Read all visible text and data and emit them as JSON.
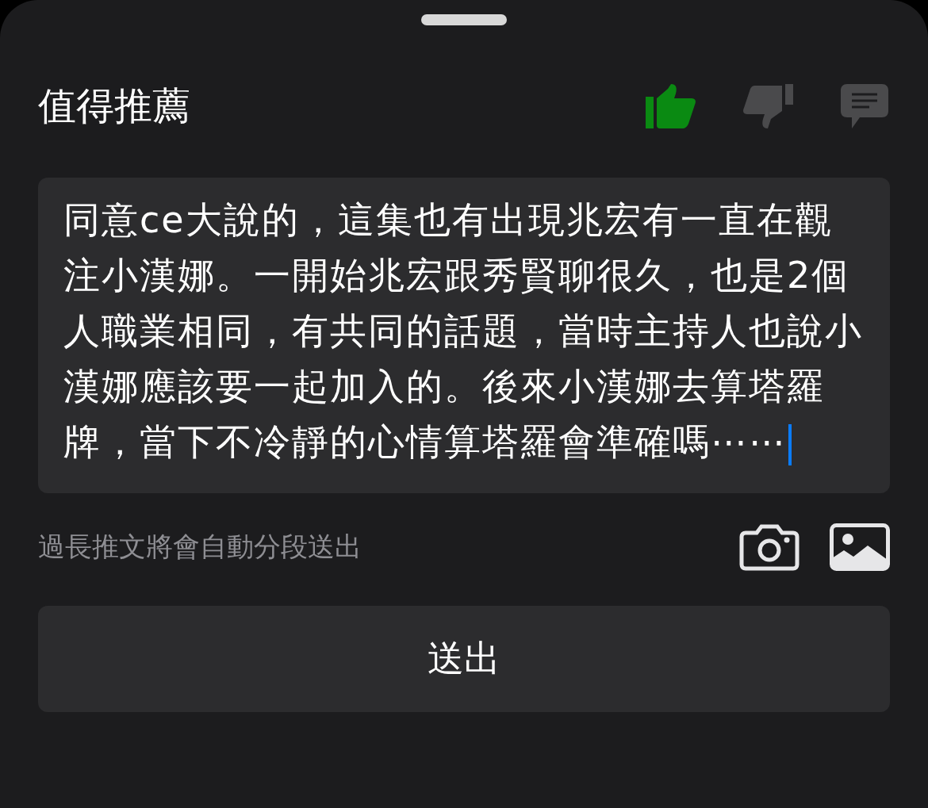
{
  "sheet": {
    "title": "值得推薦"
  },
  "reactions": [
    {
      "kind": "like",
      "selected": true
    },
    {
      "kind": "dislike",
      "selected": false
    },
    {
      "kind": "comment",
      "selected": false
    }
  ],
  "comment_field": {
    "value": "同意ce大說的，這集也有出現兆宏有一直在觀注小漢娜。一開始兆宏跟秀賢聊很久，也是2個人職業相同，有共同的話題，當時主持人也說小漢娜應該要一起加入的。後來小漢娜去算塔羅牌，當下不冷靜的心情算塔羅會準確嗎⋯⋯",
    "focused": true
  },
  "hint": "過長推文將會自動分段送出",
  "attachments": [
    {
      "kind": "camera"
    },
    {
      "kind": "image"
    }
  ],
  "submit_button": "送出"
}
